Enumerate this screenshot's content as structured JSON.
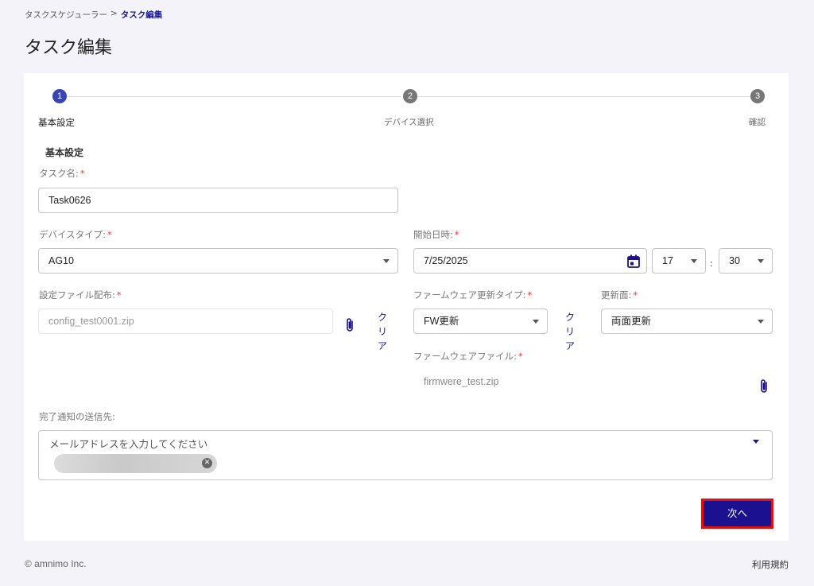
{
  "breadcrumb": {
    "parent": "タスクスケジューラー",
    "separator": ">",
    "current": "タスク編集"
  },
  "page_title": "タスク編集",
  "stepper": {
    "steps": [
      {
        "number": "1",
        "label": "基本設定"
      },
      {
        "number": "2",
        "label": "デバイス選択"
      },
      {
        "number": "3",
        "label": "確認"
      }
    ]
  },
  "section_title": "基本設定",
  "fields": {
    "task_name": {
      "label": "タスク名:",
      "required": "*",
      "value": "Task0626"
    },
    "device_type": {
      "label": "デバイスタイプ:",
      "required": "*",
      "value": "AG10"
    },
    "start_datetime": {
      "label": "開始日時:",
      "required": "*",
      "date": "7/25/2025",
      "hour": "17",
      "minute": "30",
      "separator": ":"
    },
    "config_file": {
      "label": "設定ファイル配布:",
      "required": "*",
      "value": "config_test0001.zip",
      "clear": "クリア"
    },
    "firmware_update_type": {
      "label": "ファームウェア更新タイプ:",
      "required": "*",
      "value": "FW更新",
      "clear": "クリア"
    },
    "update_side": {
      "label": "更新面:",
      "required": "*",
      "value": "両面更新"
    },
    "firmware_file": {
      "label": "ファームウェアファイル:",
      "required": "*",
      "value": "firmwere_test.zip"
    },
    "notification": {
      "label": "完了通知の送信先:",
      "placeholder": "メールアドレスを入力してください",
      "chip_close": "✕"
    }
  },
  "buttons": {
    "next": "次へ"
  },
  "footer": {
    "copyright": "© amnimo Inc.",
    "terms": "利用規約"
  },
  "colors": {
    "accent": "#1a1090",
    "step_active": "#3a45b5",
    "required": "#e53935",
    "highlight_border": "#e01010"
  }
}
